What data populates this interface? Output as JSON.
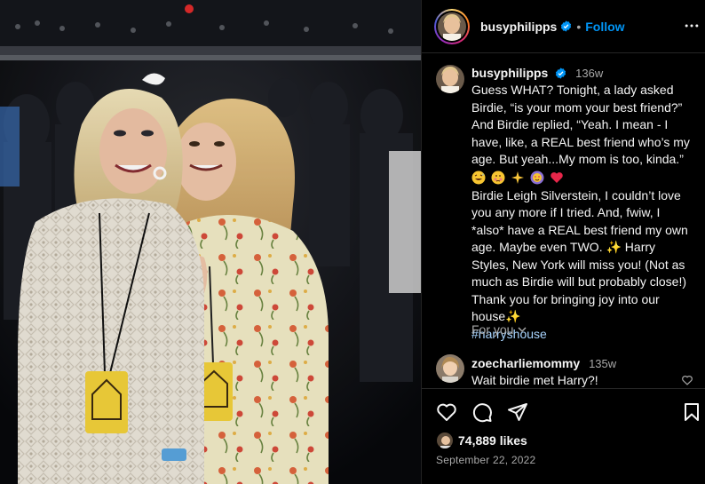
{
  "post": {
    "photo_alt": "",
    "author": {
      "username": "busyphilipps",
      "verified": true,
      "follow_label": "Follow",
      "separator": "•"
    },
    "caption": {
      "username": "busyphilipps",
      "time": "136w",
      "text_part1": "Guess WHAT? Tonight, a lady asked Birdie, “is your mom your best friend?” And Birdie replied, “Yeah. I mean - I have, like, a REAL best friend who’s my age. But yeah...My mom is too, kinda.”",
      "emojis": [
        "grin-sweat-icon",
        "woozy-face-icon",
        "sparkles-icon",
        "heart-eyes-rainbow-icon",
        "red-heart-icon"
      ],
      "text_part2": "Birdie Leigh Silverstein, I couldn’t love you any more if I tried. And, fwiw, I *also* have a REAL best friend my own age. Maybe even TWO. ✨ Harry Styles, New York will miss you! (Not as much as Birdie will but probably close!) Thank you for bringing joy into our house✨",
      "hashtag": "#harryshouse"
    },
    "for_you_label": "For you",
    "comments": [
      {
        "username": "zoecharliemommy",
        "time": "135w",
        "text": "Wait birdie met Harry?!"
      }
    ],
    "likes": "74,889 likes",
    "date": "September 22, 2022",
    "colors": {
      "background": "#000000",
      "text": "#f5f5f5",
      "muted": "#a8a8a8",
      "follow": "#0095f6",
      "verified": "#0095f6",
      "hashtag": "#a9d5ff"
    }
  }
}
